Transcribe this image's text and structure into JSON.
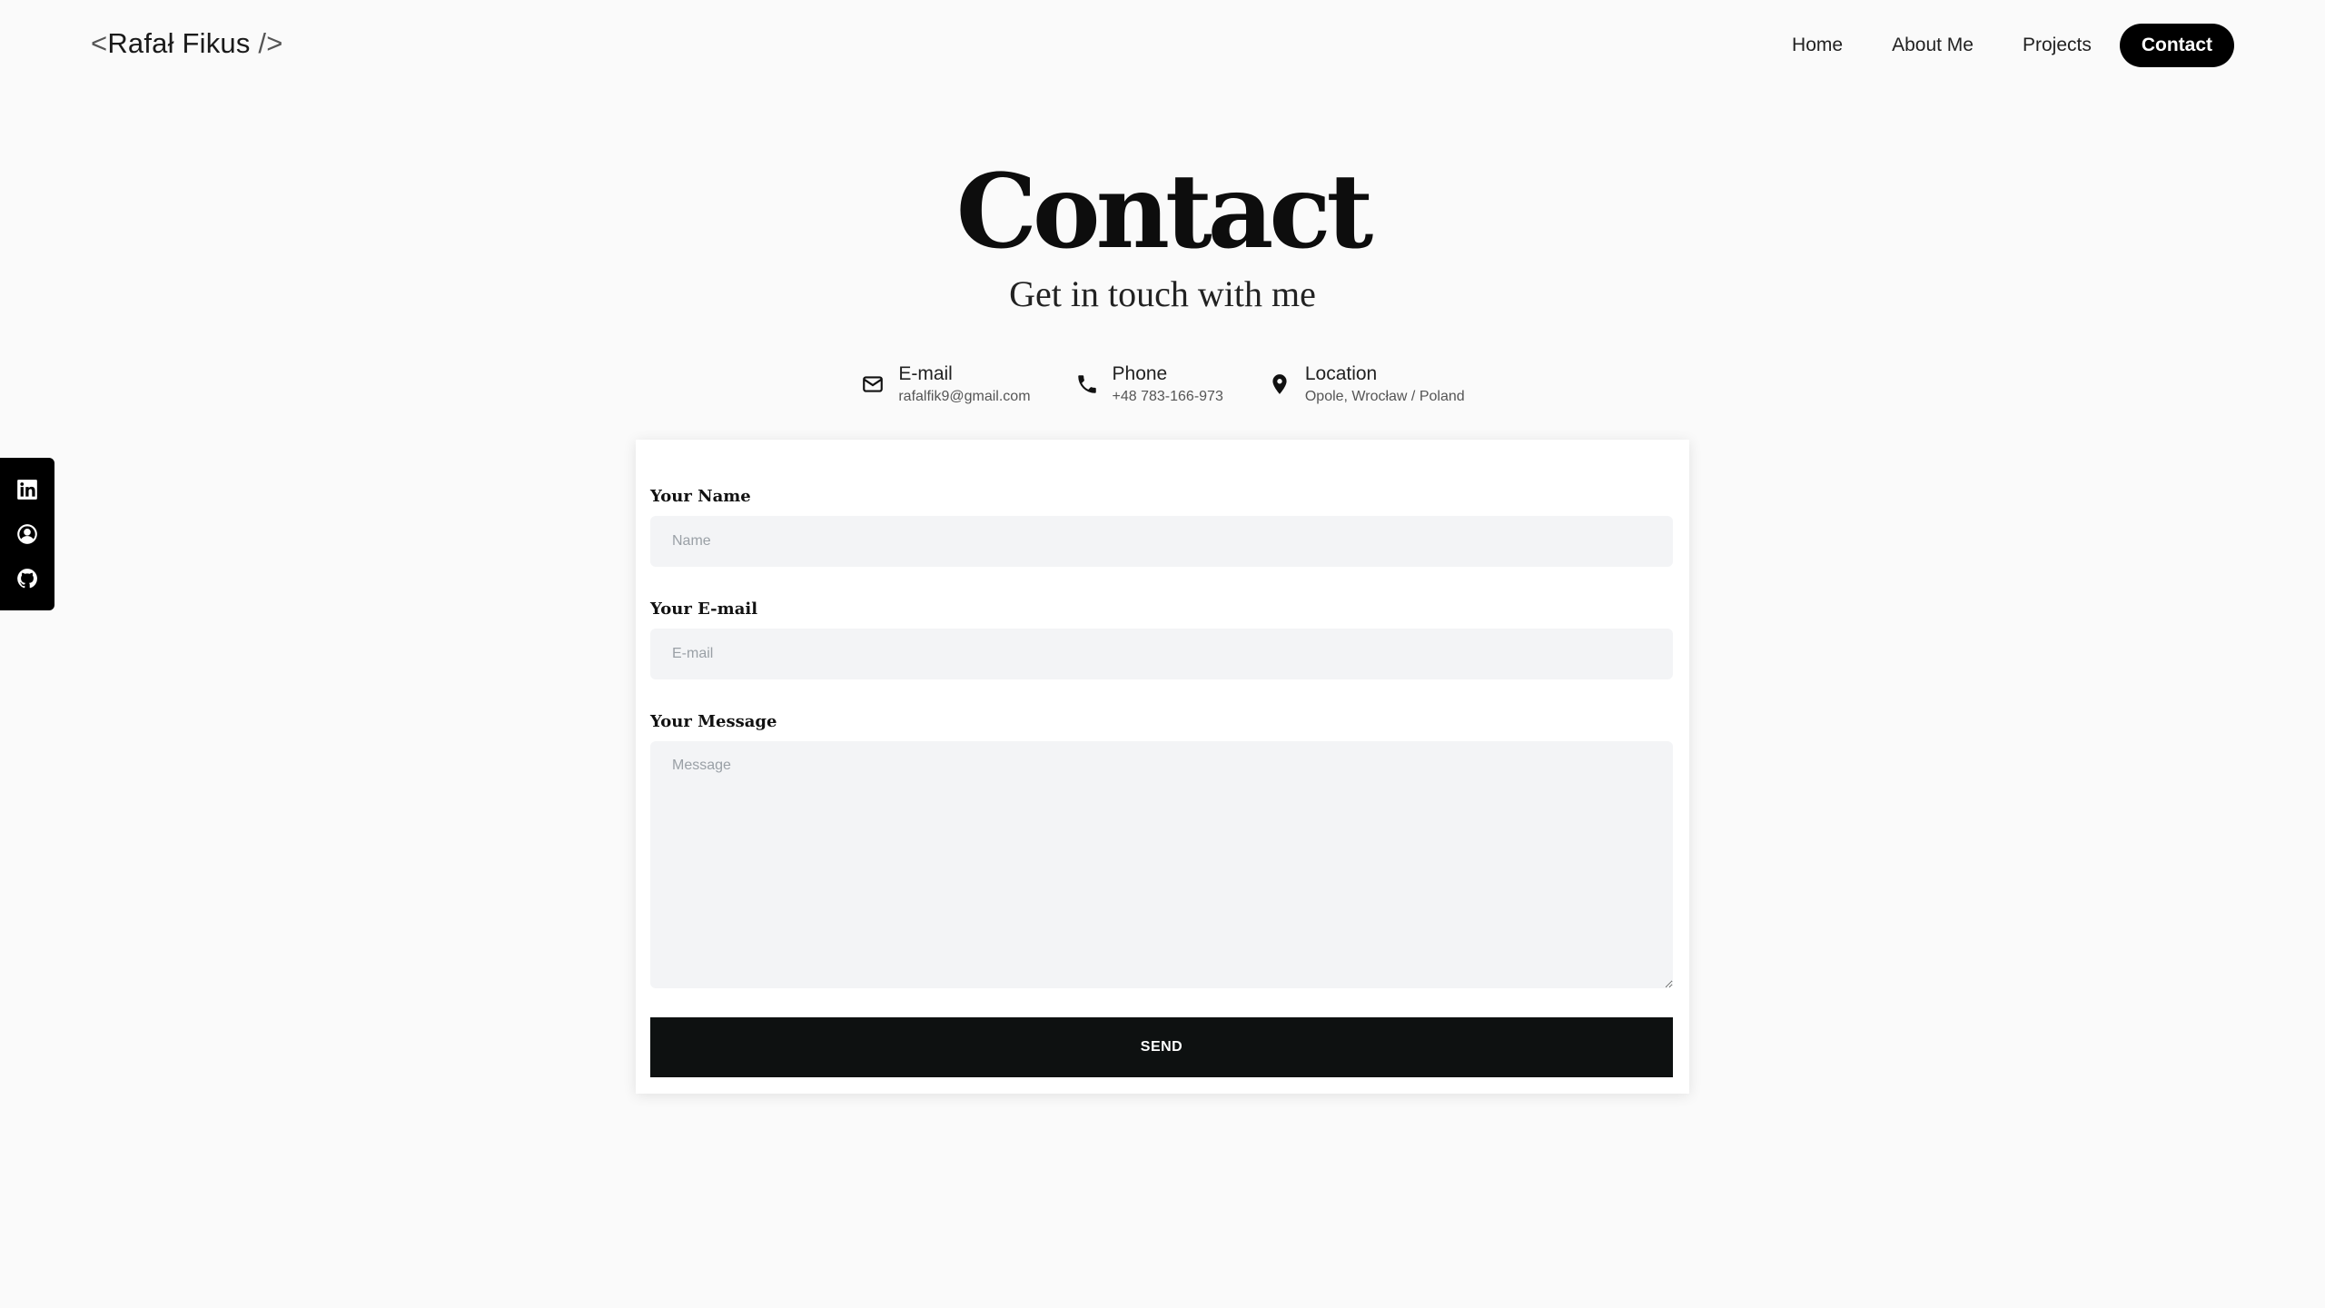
{
  "header": {
    "logo_open": "<",
    "logo_name": "Rafał Fikus",
    "logo_close": " />",
    "nav": [
      {
        "label": "Home"
      },
      {
        "label": "About Me"
      },
      {
        "label": "Projects"
      },
      {
        "label": "Contact",
        "active": true
      }
    ]
  },
  "social": {
    "icons": [
      "linkedin-icon",
      "user-circle-icon",
      "github-icon"
    ]
  },
  "hero": {
    "title": "Contact",
    "subtitle": "Get in touch with me"
  },
  "info": [
    {
      "icon": "envelope-icon",
      "label": "E-mail",
      "value": "rafalfik9@gmail.com"
    },
    {
      "icon": "phone-icon",
      "label": "Phone",
      "value": "+48 783-166-973"
    },
    {
      "icon": "location-pin-icon",
      "label": "Location",
      "value": "Opole, Wrocław / Poland"
    }
  ],
  "form": {
    "name_label": "Your Name",
    "name_placeholder": "Name",
    "email_label": "Your E-mail",
    "email_placeholder": "E-mail",
    "message_label": "Your Message",
    "message_placeholder": "Message",
    "send_label": "SEND"
  },
  "colors": {
    "background": "#fafafa",
    "accent": "#000000",
    "field_bg": "#f3f4f6",
    "button_bg": "#0e1111"
  }
}
